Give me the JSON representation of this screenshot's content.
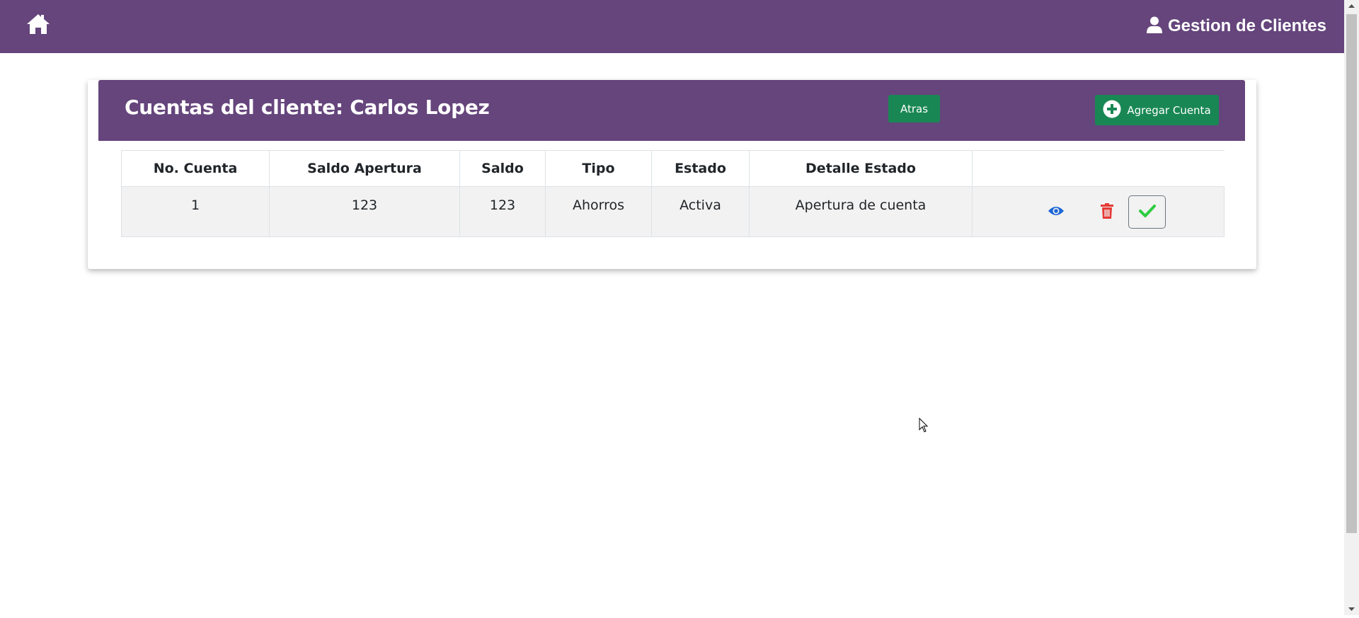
{
  "navbar": {
    "home_icon": "home-icon",
    "user_icon": "user-icon",
    "title": "Gestion de Clientes",
    "background": "#65457c"
  },
  "card": {
    "title": "Cuentas del cliente: Carlos Lopez",
    "back_label": "Atras",
    "add_label": "Agregar Cuenta",
    "add_icon": "plus-circle-icon"
  },
  "table": {
    "headers": [
      "No. Cuenta",
      "Saldo Apertura",
      "Saldo",
      "Tipo",
      "Estado",
      "Detalle Estado",
      ""
    ],
    "rows": [
      {
        "numero": "1",
        "saldo_apertura": "123",
        "saldo": "123",
        "tipo": "Ahorros",
        "estado": "Activa",
        "detalle": "Apertura de cuenta",
        "actions": [
          "eye-icon",
          "trash-icon",
          "check-icon"
        ]
      }
    ]
  },
  "colors": {
    "brand_purple": "#65457c",
    "button_green": "#198754",
    "eye_blue": "#1a66d6",
    "trash_red": "#e53935",
    "check_green": "#2ecc40"
  }
}
